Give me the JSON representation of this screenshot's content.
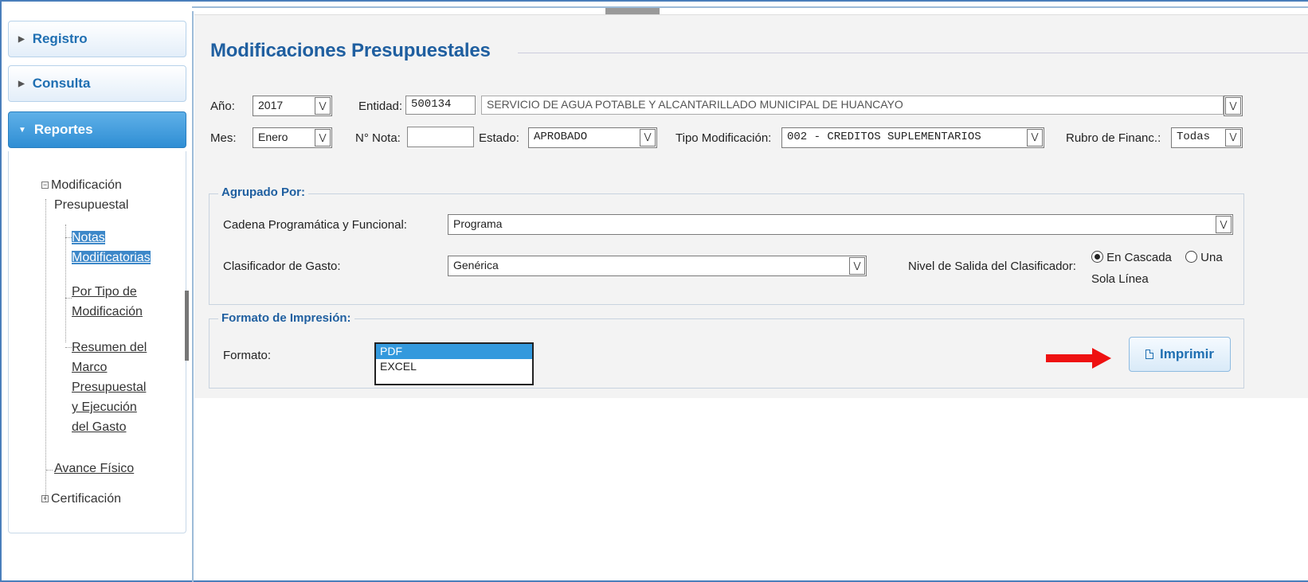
{
  "sidebar": {
    "sections": [
      {
        "label": "Registro",
        "expanded": false
      },
      {
        "label": "Consulta",
        "expanded": false
      },
      {
        "label": "Reportes",
        "expanded": true
      }
    ],
    "tree": {
      "modificacion": [
        "Modificación",
        "Presupuestal"
      ],
      "notas": [
        "Notas",
        "Modificatorias"
      ],
      "por_tipo": [
        "Por Tipo de",
        "Modificación"
      ],
      "resumen": [
        "Resumen del",
        "Marco",
        "Presupuestal",
        "y Ejecución",
        "del Gasto"
      ],
      "avance": "Avance Físico",
      "certificacion": "Certificación"
    }
  },
  "main": {
    "title": "Modificaciones Presupuestales",
    "filters": {
      "anio_label": "Año:",
      "anio_value": "2017",
      "entidad_label": "Entidad:",
      "entidad_code": "500134",
      "entidad_name": "SERVICIO DE AGUA POTABLE Y ALCANTARILLADO MUNICIPAL DE HUANCAYO",
      "mes_label": "Mes:",
      "mes_value": "Enero",
      "nota_label": "N° Nota:",
      "nota_value": "",
      "estado_label": "Estado:",
      "estado_value": "APROBADO",
      "tipo_label": "Tipo Modificación:",
      "tipo_value": "002 - CREDITOS SUPLEMENTARIOS",
      "rubro_label": "Rubro de Financ.:",
      "rubro_value": "Todas"
    },
    "agrupado": {
      "legend": "Agrupado Por:",
      "cadena_label": "Cadena Programática y Funcional:",
      "cadena_value": "Programa",
      "clasificador_label": "Clasificador de Gasto:",
      "clasificador_value": "Genérica",
      "nivel_label": "Nivel de Salida del Clasificador:",
      "opt_cascada": "En Cascada",
      "opt_una_1": "Una",
      "opt_una_2": "Sola Línea"
    },
    "formato": {
      "legend": "Formato de Impresión:",
      "label": "Formato:",
      "options": [
        "PDF",
        "EXCEL"
      ],
      "selected": "PDF",
      "print_button": "Imprimir"
    }
  },
  "colors": {
    "accent": "#1f5fa0",
    "active_header": "#2f8ed4",
    "selection": "#3399dd",
    "annotation_arrow": "#ee1111"
  }
}
